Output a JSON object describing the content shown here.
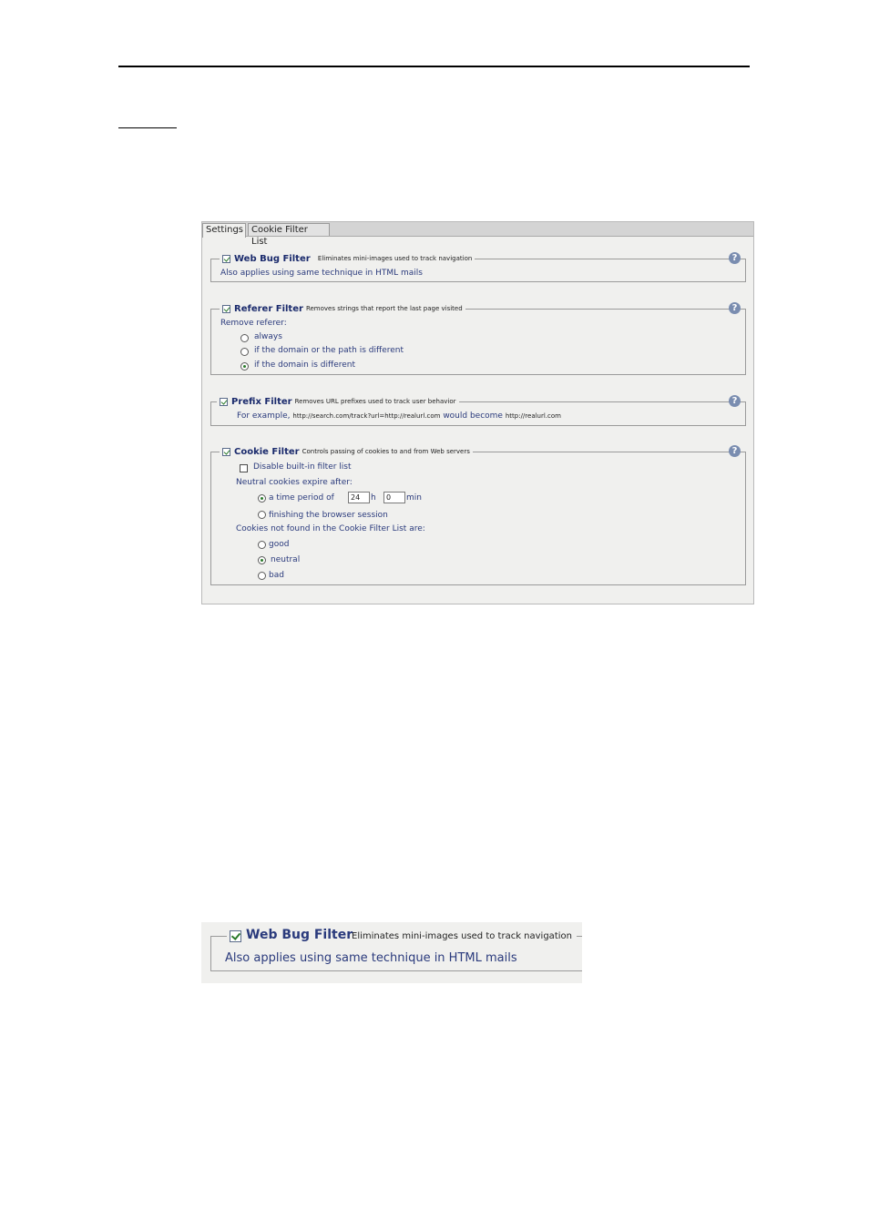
{
  "tabs": [
    {
      "label": "Settings",
      "active": true
    },
    {
      "label": "Cookie Filter List",
      "active": false
    }
  ],
  "help_glyph": "?",
  "web_bug": {
    "title": "Web Bug Filter",
    "desc": "Eliminates mini-images used to track navigation",
    "checked": true,
    "note": "Also applies using same technique in HTML mails"
  },
  "referer": {
    "title": "Referer Filter",
    "desc": "Removes strings that report the last page visited",
    "checked": true,
    "label": "Remove referer:",
    "options": [
      {
        "label": "always",
        "selected": false
      },
      {
        "label": "if the domain or the path is different",
        "selected": false
      },
      {
        "label": "if the domain is different",
        "selected": true
      }
    ]
  },
  "prefix": {
    "title": "Prefix Filter",
    "desc": "Removes URL prefixes used to track user behavior",
    "checked": true,
    "example_prefix": "For example,",
    "example_url": "http://search.com/track?url=http://realurl.com",
    "example_mid": "would become",
    "example_result": "http://realurl.com"
  },
  "cookie": {
    "title": "Cookie Filter",
    "desc": "Controls passing of cookies to and from Web servers",
    "checked": true,
    "disable_label": "Disable built-in filter list",
    "disable_checked": false,
    "expire_label": "Neutral cookies expire after:",
    "time_period_label": "a time period of",
    "hours_value": "24",
    "hours_unit": "h",
    "minutes_value": "0",
    "minutes_unit": "min",
    "session_label": "finishing the browser session",
    "time_period_selected": true,
    "notfound_label": "Cookies not found in the Cookie Filter List are:",
    "classes": [
      {
        "label": "good",
        "selected": false
      },
      {
        "label": "neutral",
        "selected": true
      },
      {
        "label": "bad",
        "selected": false
      }
    ]
  },
  "inset": {
    "title": "Web Bug Filter",
    "desc": "Eliminates mini-images used to track navigation",
    "note": "Also applies using same technique in HTML mails"
  }
}
